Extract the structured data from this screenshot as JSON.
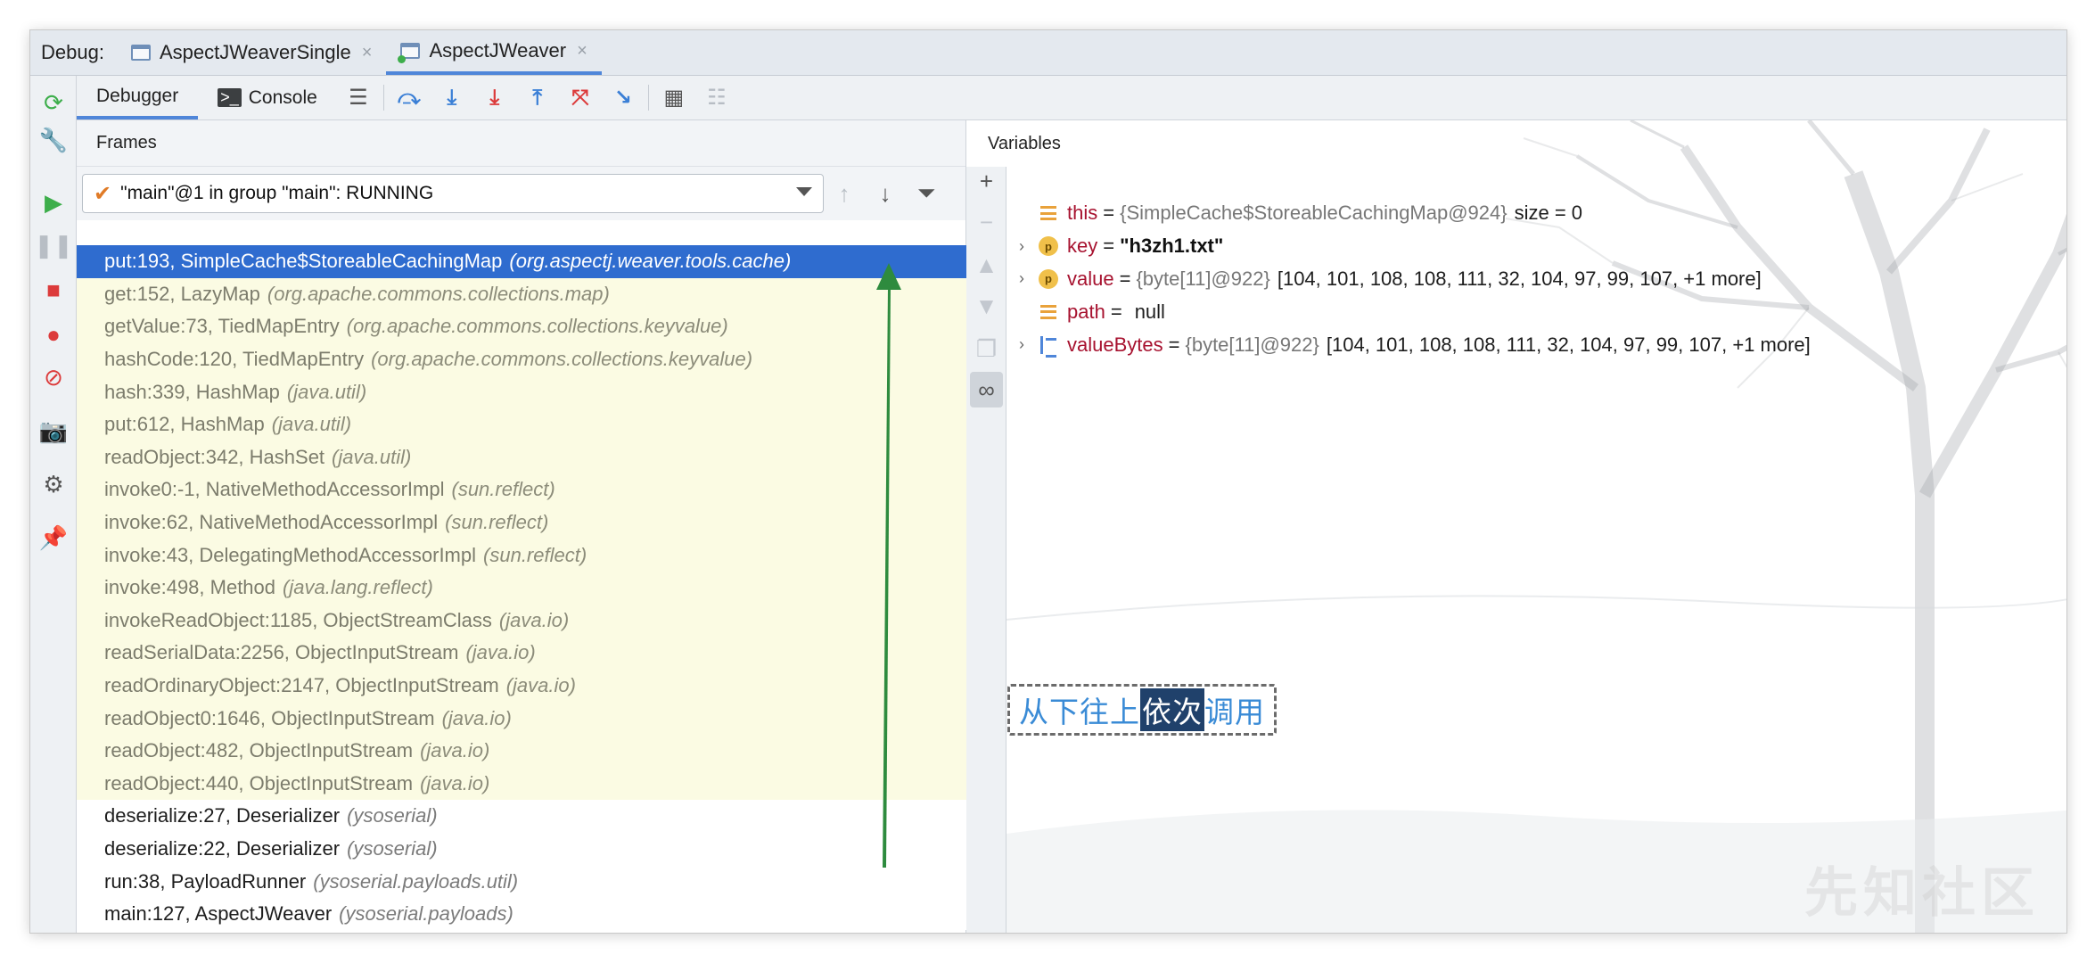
{
  "debug_bar": {
    "label": "Debug:",
    "tabs": [
      {
        "label": "AspectJWeaverSingle",
        "active": false
      },
      {
        "label": "AspectJWeaver",
        "active": true
      }
    ],
    "close_glyph": "×"
  },
  "sub_toolbar": {
    "tabs": [
      {
        "label": "Debugger",
        "active": true
      },
      {
        "label": "Console",
        "active": false
      }
    ],
    "buttons": [
      "menu-icon",
      "step-over-icon",
      "step-into-icon",
      "force-step-into-icon",
      "step-out-icon",
      "drop-frame-icon",
      "run-to-cursor-icon",
      "evaluate-expression-icon",
      "trace-icon"
    ]
  },
  "frames": {
    "header": "Frames",
    "thread": {
      "check": "✔",
      "value": "\"main\"@1 in group \"main\": RUNNING"
    },
    "items": [
      {
        "method": "put:193, SimpleCache$StoreableCachingMap",
        "pkg": "(org.aspectj.weaver.tools.cache)",
        "kind": "selected"
      },
      {
        "method": "get:152, LazyMap",
        "pkg": "(org.apache.commons.collections.map)",
        "kind": "lib"
      },
      {
        "method": "getValue:73, TiedMapEntry",
        "pkg": "(org.apache.commons.collections.keyvalue)",
        "kind": "lib"
      },
      {
        "method": "hashCode:120, TiedMapEntry",
        "pkg": "(org.apache.commons.collections.keyvalue)",
        "kind": "lib"
      },
      {
        "method": "hash:339, HashMap",
        "pkg": "(java.util)",
        "kind": "lib"
      },
      {
        "method": "put:612, HashMap",
        "pkg": "(java.util)",
        "kind": "lib"
      },
      {
        "method": "readObject:342, HashSet",
        "pkg": "(java.util)",
        "kind": "lib"
      },
      {
        "method": "invoke0:-1, NativeMethodAccessorImpl",
        "pkg": "(sun.reflect)",
        "kind": "lib"
      },
      {
        "method": "invoke:62, NativeMethodAccessorImpl",
        "pkg": "(sun.reflect)",
        "kind": "lib"
      },
      {
        "method": "invoke:43, DelegatingMethodAccessorImpl",
        "pkg": "(sun.reflect)",
        "kind": "lib"
      },
      {
        "method": "invoke:498, Method",
        "pkg": "(java.lang.reflect)",
        "kind": "lib"
      },
      {
        "method": "invokeReadObject:1185, ObjectStreamClass",
        "pkg": "(java.io)",
        "kind": "lib"
      },
      {
        "method": "readSerialData:2256, ObjectInputStream",
        "pkg": "(java.io)",
        "kind": "lib"
      },
      {
        "method": "readOrdinaryObject:2147, ObjectInputStream",
        "pkg": "(java.io)",
        "kind": "lib"
      },
      {
        "method": "readObject0:1646, ObjectInputStream",
        "pkg": "(java.io)",
        "kind": "lib"
      },
      {
        "method": "readObject:482, ObjectInputStream",
        "pkg": "(java.io)",
        "kind": "lib"
      },
      {
        "method": "readObject:440, ObjectInputStream",
        "pkg": "(java.io)",
        "kind": "lib"
      },
      {
        "method": "deserialize:27, Deserializer",
        "pkg": "(ysoserial)",
        "kind": "user"
      },
      {
        "method": "deserialize:22, Deserializer",
        "pkg": "(ysoserial)",
        "kind": "user"
      },
      {
        "method": "run:38, PayloadRunner",
        "pkg": "(ysoserial.payloads.util)",
        "kind": "user"
      },
      {
        "method": "main:127, AspectJWeaver",
        "pkg": "(ysoserial.payloads)",
        "kind": "user"
      }
    ]
  },
  "variables": {
    "header": "Variables",
    "items": [
      {
        "expandable": false,
        "icon": "field-icon",
        "name": "this",
        "eq": "=",
        "type": "{SimpleCache$StoreableCachingMap@924}",
        "value": "size = 0",
        "string": ""
      },
      {
        "expandable": true,
        "icon": "param-icon",
        "name": "key",
        "eq": "=",
        "type": "",
        "value": "",
        "string": "\"h3zh1.txt\""
      },
      {
        "expandable": true,
        "icon": "param-icon",
        "name": "value",
        "eq": "=",
        "type": "{byte[11]@922}",
        "value": "[104, 101, 108, 108, 111, 32, 104, 97, 99, 107, +1 more]",
        "string": ""
      },
      {
        "expandable": false,
        "icon": "field-icon",
        "name": "path",
        "eq": "=",
        "type": "",
        "value": "null",
        "string": ""
      },
      {
        "expandable": true,
        "icon": "array-icon",
        "name": "valueBytes",
        "eq": "=",
        "type": "{byte[11]@922}",
        "value": "[104, 101, 108, 108, 111, 32, 104, 97, 99, 107, +1 more]",
        "string": ""
      }
    ]
  },
  "annotation": {
    "pre": "从下往上",
    "highlight": "依次",
    "post": "调用"
  },
  "watermark": "先知社区",
  "colors": {
    "selected_row": "#2f6ccf",
    "library_row": "#fbfbe3",
    "arrow": "#2e8b3e",
    "annotation_text": "#3a8bd6"
  }
}
